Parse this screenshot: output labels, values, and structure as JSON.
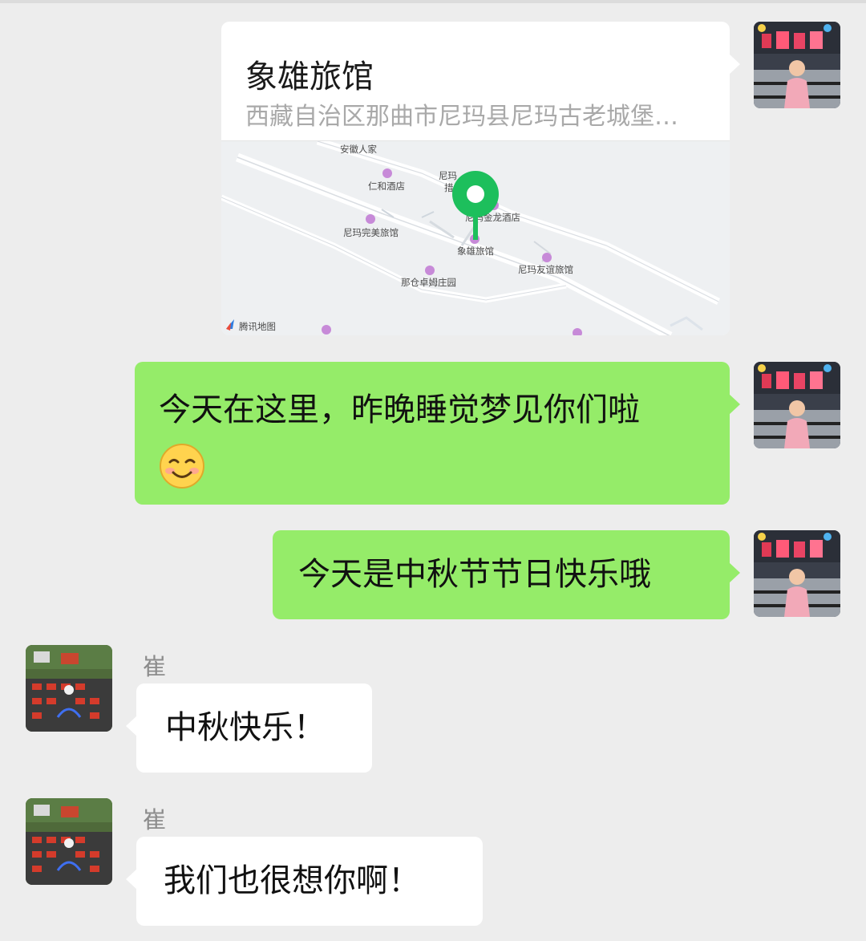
{
  "location": {
    "title": "象雄旅馆",
    "address": "西藏自治区那曲市尼玛县尼玛古老城堡…",
    "map_labels": [
      "安徽人家",
      "仁和酒店",
      "尼玛",
      "措",
      "尼玛金龙酒店",
      "尼玛完美旅馆",
      "象雄旅馆",
      "尼玛友谊旅馆",
      "那仓卓姆庄园"
    ],
    "map_brand": "腾讯地图"
  },
  "messages": [
    {
      "text": "今天在这里，昨晚睡觉梦见你们啦",
      "emoji": "smiling-face-icon"
    },
    {
      "text": "今天是中秋节节日快乐哦"
    },
    {
      "sender": "崔",
      "text": "中秋快乐！"
    },
    {
      "sender": "崔",
      "text": "我们也很想你啊！"
    }
  ],
  "colors": {
    "background": "#ededed",
    "sent_bubble": "#95ec69",
    "received_bubble": "#ffffff",
    "map_pin": "#1dbf5c"
  }
}
